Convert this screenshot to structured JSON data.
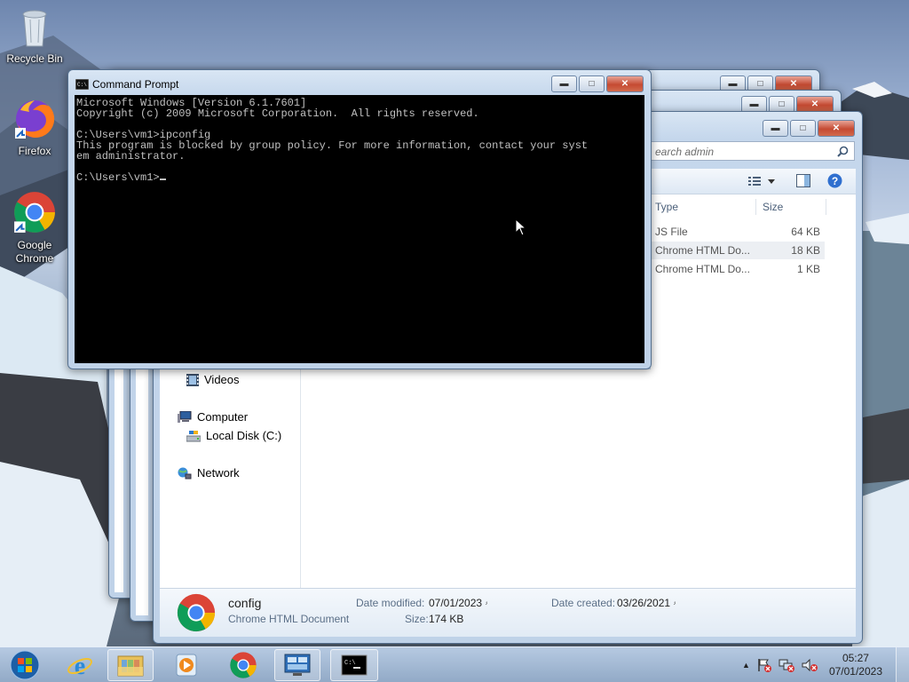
{
  "desktop": {
    "icons": [
      {
        "label": "Recycle Bin",
        "icon": "recycle-bin-icon"
      },
      {
        "label": "Firefox",
        "icon": "firefox-icon"
      },
      {
        "label": "Google Chrome",
        "icon": "chrome-icon"
      }
    ]
  },
  "explorer": {
    "search_placeholder": "earch admin",
    "columns": {
      "type": "Type",
      "size": "Size"
    },
    "rows": [
      {
        "type": "JS File",
        "size": "64 KB"
      },
      {
        "type": "Chrome HTML Do...",
        "size": "18 KB"
      },
      {
        "type": "Chrome HTML Do...",
        "size": "1 KB"
      }
    ],
    "nav": {
      "videos": "Videos",
      "computer": "Computer",
      "local_disk": "Local Disk (C:)",
      "network": "Network"
    },
    "details": {
      "name": "config",
      "kind": "Chrome HTML Document",
      "date_modified_label": "Date modified:",
      "date_modified": "07/01/2023 ۥ",
      "size_label": "Size:",
      "size": "174 KB",
      "date_created_label": "Date created:",
      "date_created": "03/26/2021 ۥ"
    }
  },
  "cmd": {
    "title": "Command Prompt",
    "lines": [
      "Microsoft Windows [Version 6.1.7601]",
      "Copyright (c) 2009 Microsoft Corporation.  All rights reserved.",
      "",
      "C:\\Users\\vm1>ipconfig",
      "This program is blocked by group policy. For more information, contact your syst",
      "em administrator.",
      "",
      "C:\\Users\\vm1>"
    ]
  },
  "taskbar": {
    "items": [
      "start-orb",
      "internet-explorer",
      "file-explorer",
      "media-player",
      "chrome",
      "control-panel",
      "command-prompt"
    ],
    "clock_time": "05:27",
    "clock_date": "07/01/2023"
  },
  "colors": {
    "console_bg": "#000000",
    "console_fg": "#c0c0c0",
    "close_red": "#c54a32"
  }
}
